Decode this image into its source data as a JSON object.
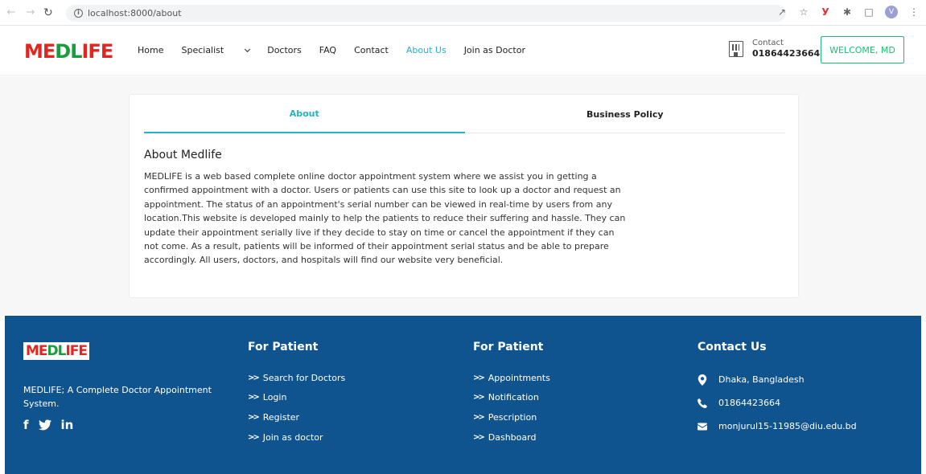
{
  "browser": {
    "url": "localhost:8000/about",
    "profile_initial": "V"
  },
  "header": {
    "logo": {
      "part1": "ME",
      "part2": "DL",
      "part3": "IFE"
    },
    "nav": {
      "home": "Home",
      "specialist": "Specialist",
      "doctors": "Doctors",
      "faq": "FAQ",
      "contact": "Contact",
      "about": "About Us",
      "join": "Join as Doctor"
    },
    "contact_label": "Contact",
    "contact_number": "01864423664",
    "welcome_button": "WELCOME, MD"
  },
  "main": {
    "tabs": [
      "About",
      "Business Policy"
    ],
    "active_tab": "About",
    "about_title": "About Medlife",
    "about_text": "MEDLIFE is a web based complete online doctor appointment system where we assist you in getting a confirmed appointment with a doctor. Users or patients can use this site to look up a doctor and request an appointment. The status of an appointment's serial number can be viewed in real-time by users from any location.This website is developed mainly to help the patients to reduce their suffering and hassle. They can update their appointment serially live if they decide to stay on time or cancel the appointment if they can not come. As a result, patients will be informed of their appointment serial status and be able to prepare accordingly. All users, doctors, and hospitals will find our website very beneficial."
  },
  "footer": {
    "tagline": "MEDLIFE; A Complete Doctor Appointment System.",
    "social": [
      "f",
      "in"
    ],
    "col1": {
      "title": "For Patient",
      "links": [
        "Search for Doctors",
        "Login",
        "Register",
        "Join as doctor"
      ]
    },
    "col2": {
      "title": "For Patient",
      "links": [
        "Appointments",
        "Notification",
        "Pescription",
        "Dashboard"
      ]
    },
    "contact": {
      "title": "Contact Us",
      "address": "Dhaka, Bangladesh",
      "phone": "01864423664",
      "email": "monjurul15-11985@diu.edu.bd"
    }
  },
  "colors": {
    "accent": "#1fb5c7",
    "welcome_green": "#1dbf73",
    "footer_bg": "#10548f",
    "logo_red": "#e0261f",
    "logo_green": "#1a9c3c"
  }
}
